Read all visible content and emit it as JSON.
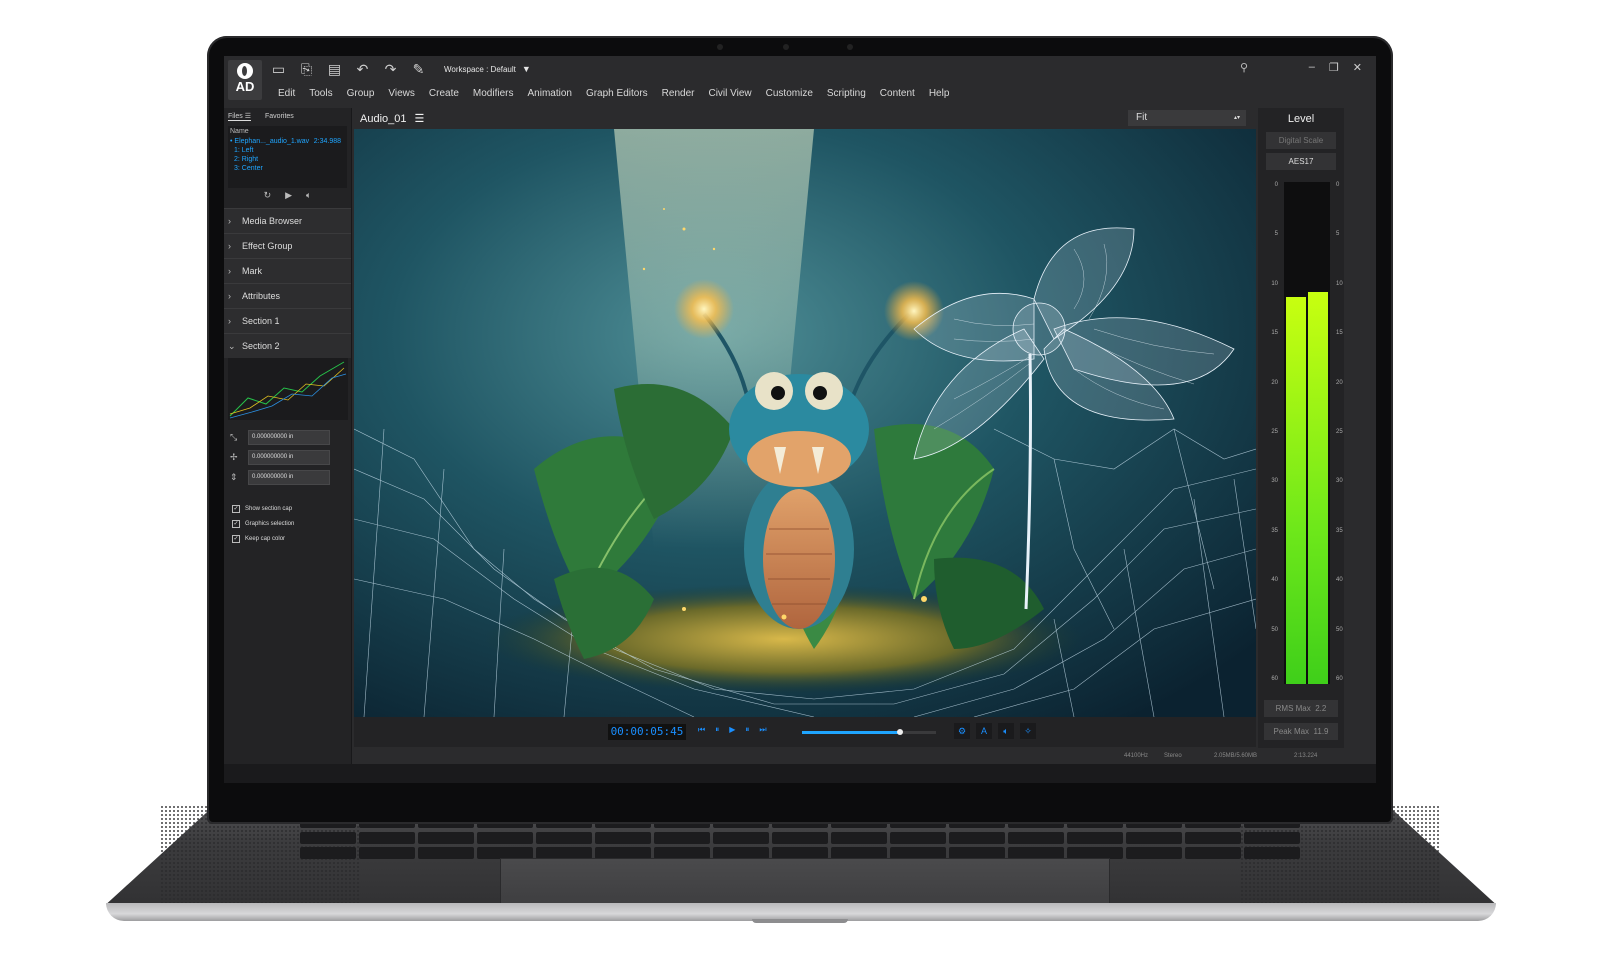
{
  "app": {
    "logo_text": "AD",
    "workspace_label": "Workspace : Default"
  },
  "menu": [
    "Edit",
    "Tools",
    "Group",
    "Views",
    "Create",
    "Modifiers",
    "Animation",
    "Graph Editors",
    "Render",
    "Civil View",
    "Customize",
    "Scripting",
    "Content",
    "Help"
  ],
  "left_panel": {
    "tabs": [
      "Files",
      "Favorites"
    ],
    "files_header": "Name",
    "file": {
      "name": "Elephan..._audio_1.wav",
      "duration": "2:34.988"
    },
    "channels": [
      "1: Left",
      "2: Right",
      "3: Center"
    ],
    "sections": [
      {
        "label": "Media Browser",
        "expanded": false
      },
      {
        "label": "Effect Group",
        "expanded": false
      },
      {
        "label": "Mark",
        "expanded": false
      },
      {
        "label": "Attributes",
        "expanded": false
      },
      {
        "label": "Section 1",
        "expanded": false
      },
      {
        "label": "Section 2",
        "expanded": true
      }
    ],
    "fields": [
      "0.000000000 in",
      "0.000000000 in",
      "0.000000000 in"
    ],
    "checkboxes": [
      {
        "label": "Show section cap",
        "checked": true
      },
      {
        "label": "Graphics selection",
        "checked": true
      },
      {
        "label": "Keep cap color",
        "checked": true
      }
    ]
  },
  "viewer": {
    "title": "Audio_01",
    "zoom": "Fit",
    "timecode": "00:00:05:45",
    "progress": 0.73,
    "right_buttons": [
      "A"
    ]
  },
  "status": {
    "sample_rate": "44100Hz",
    "channels": "Stereo",
    "memory": "2.05MB/5.60MB",
    "time": "2:13.224"
  },
  "level_panel": {
    "title": "Level",
    "buttons": [
      "Digital Scale",
      "AES17"
    ],
    "scale": [
      "0",
      "5",
      "10",
      "15",
      "20",
      "25",
      "30",
      "35",
      "40",
      "50",
      "60"
    ],
    "left_level": 0.77,
    "right_level": 0.78,
    "rms_label": "RMS Max",
    "rms_value": "2.2",
    "peak_label": "Peak Max",
    "peak_value": "11.9"
  },
  "colors": {
    "accent": "#1fa5ff",
    "meter_top": "#c8ff10",
    "meter_bottom": "#3fcf1a",
    "panel": "#232325",
    "chrome": "#2b2b2d"
  }
}
